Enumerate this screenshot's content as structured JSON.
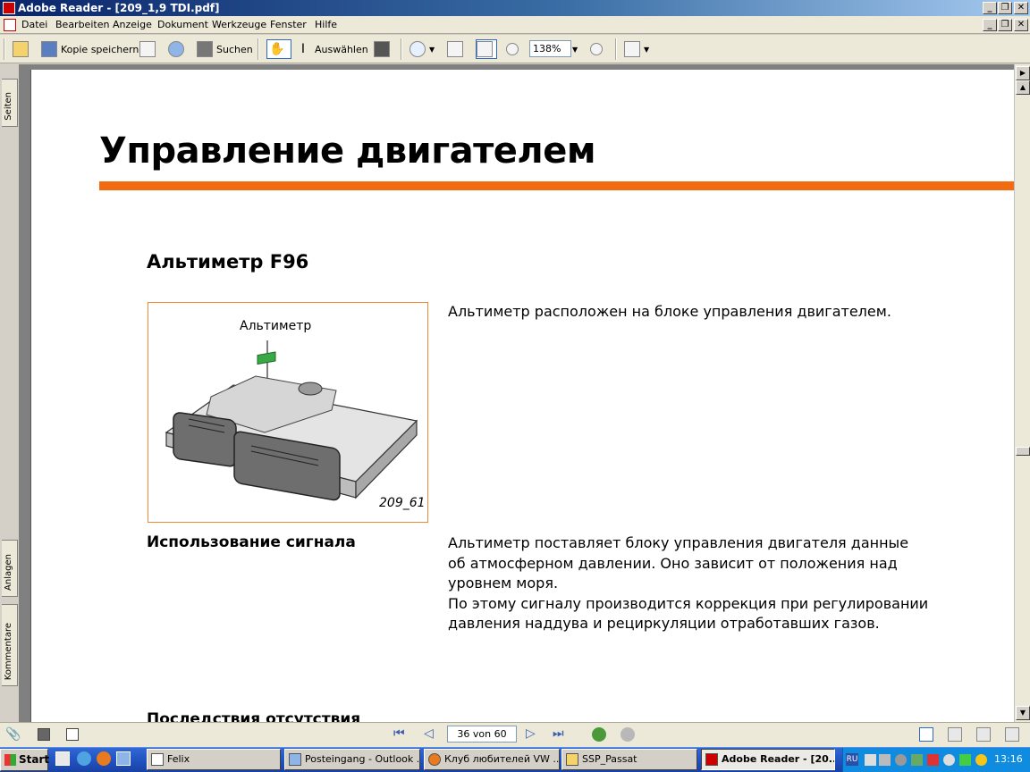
{
  "window": {
    "title": "Adobe Reader - [209_1,9 TDI.pdf]"
  },
  "menu": [
    "Datei",
    "Bearbeiten",
    "Anzeige",
    "Dokument",
    "Werkzeuge",
    "Fenster",
    "Hilfe"
  ],
  "toolbar": {
    "save_label": "Kopie speichern",
    "search_label": "Suchen",
    "select_label": "Auswählen",
    "zoom_value": "138%"
  },
  "side_tabs": {
    "pages": "Seiten",
    "attachments": "Anlagen",
    "comments": "Kommentare"
  },
  "doc": {
    "title": "Управление двигателем",
    "section_title": "Альтиметр F96",
    "figure_label": "Альтиметр",
    "figure_id": "209_61",
    "intro_text": "Альтиметр расположен на блоке управления двигателем.",
    "signal_heading": "Использование сигнала",
    "signal_lines": [
      "Альтиметр поставляет блоку управления двигателя данные",
      "об атмосферном давлении. Оно зависит от положения над",
      "уровнем моря.",
      "По этому сигналу производится коррекция при регулировании",
      "давления наддува и рециркуляции отработавших газов."
    ],
    "cut_heading": "Последствия отсутствия"
  },
  "nav": {
    "page_field": "36 von 60"
  },
  "taskbar": {
    "start": "Start",
    "tasks": [
      "Felix",
      "Posteingang - Outlook ...",
      "Клуб любителей VW ...",
      "SSP_Passat",
      "Adobe Reader - [20..."
    ],
    "lang": "RU",
    "clock": "13:16"
  },
  "colors": {
    "accent_rule": "#f26b10",
    "figure_border": "#f08a30",
    "sensor": "#3aa845",
    "titlebar": "#0a246a"
  }
}
